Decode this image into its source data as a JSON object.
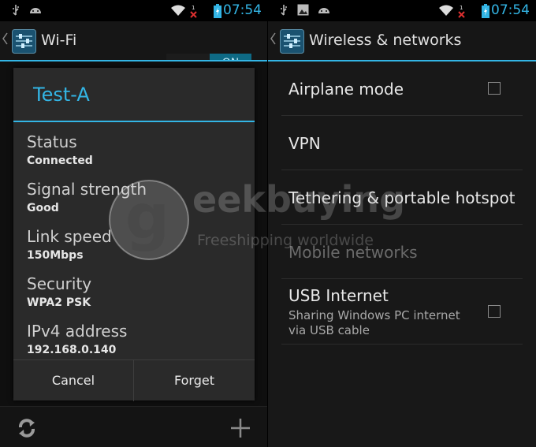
{
  "left": {
    "status": {
      "time": "07:54",
      "icons": [
        "usb-icon",
        "android-icon",
        "wifi-icon",
        "signal-off-icon",
        "battery-charging-icon"
      ]
    },
    "actionbar": {
      "title": "Wi-Fi",
      "toggle": "ON"
    },
    "dialog": {
      "title": "Test-A",
      "fields": [
        {
          "label": "Status",
          "value": "Connected"
        },
        {
          "label": "Signal strength",
          "value": "Good"
        },
        {
          "label": "Link speed",
          "value": "150Mbps"
        },
        {
          "label": "Security",
          "value": "WPA2 PSK"
        },
        {
          "label": "IPv4 address",
          "value": "192.168.0.140"
        }
      ],
      "cancel": "Cancel",
      "forget": "Forget"
    },
    "bottombar": {
      "icons": [
        "refresh-icon",
        "add-icon"
      ]
    }
  },
  "right": {
    "status": {
      "time": "07:54",
      "icons": [
        "usb-icon",
        "image-icon",
        "android-icon",
        "wifi-icon",
        "signal-off-icon",
        "battery-charging-icon"
      ]
    },
    "actionbar": {
      "title": "Wireless & networks"
    },
    "items": [
      {
        "title": "Airplane mode",
        "checked": false
      },
      {
        "title": "VPN"
      },
      {
        "title": "Tethering & portable hotspot"
      },
      {
        "title": "Mobile networks",
        "disabled": true
      },
      {
        "title": "USB Internet",
        "subtitle": "Sharing Windows PC internet via USB cable",
        "checked": false
      }
    ]
  },
  "watermark": {
    "letters": "g eekbuying",
    "brand": "eekbuying",
    "tagline": "Freeshipping worldwide"
  },
  "colors": {
    "accent": "#33b5e5",
    "toggle_on": "#0e6a85"
  }
}
